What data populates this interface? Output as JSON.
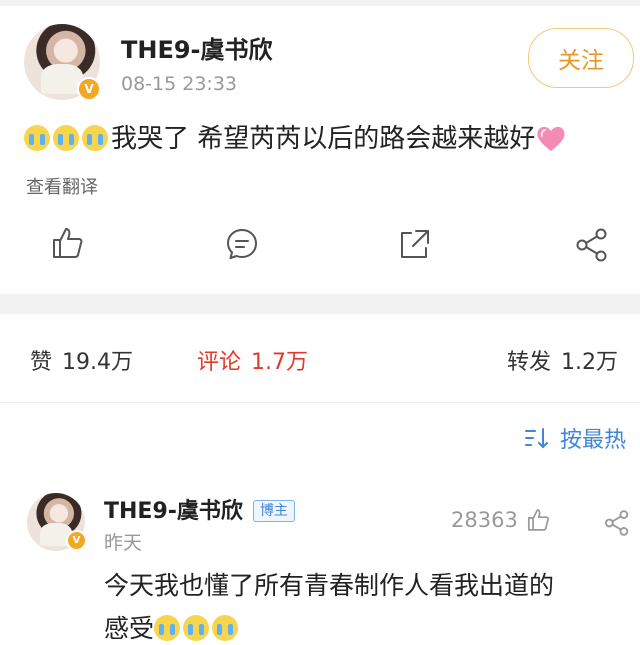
{
  "post": {
    "author": "THE9-虞书欣",
    "time": "08-15 23:33",
    "follow_label": "关注",
    "text": "我哭了 希望芮芮以后的路会越来越好",
    "emoji_count": 3,
    "emoji_icon": "crying-emoji",
    "trailing_icon": "pink-heart-emoji",
    "translate_label": "查看翻译",
    "actions": [
      "like-icon",
      "comment-icon",
      "repost-icon",
      "share-icon"
    ]
  },
  "stats": {
    "likes_label": "赞",
    "likes_value": "19.4万",
    "comments_label": "评论",
    "comments_value": "1.7万",
    "reposts_label": "转发",
    "reposts_value": "1.2万"
  },
  "sort": {
    "label": "按最热",
    "icon": "sort-icon"
  },
  "comment": {
    "author": "THE9-虞书欣",
    "badge": "博主",
    "time": "昨天",
    "like_count": "28363",
    "text_line1": "今天我也懂了所有青春制作人看我出道的",
    "text_line2": "感受"
  },
  "colors": {
    "accent_orange": "#e8972a",
    "active_red": "#e1392a",
    "link_blue": "#3f86d6",
    "verified_gold": "#f3a823"
  }
}
